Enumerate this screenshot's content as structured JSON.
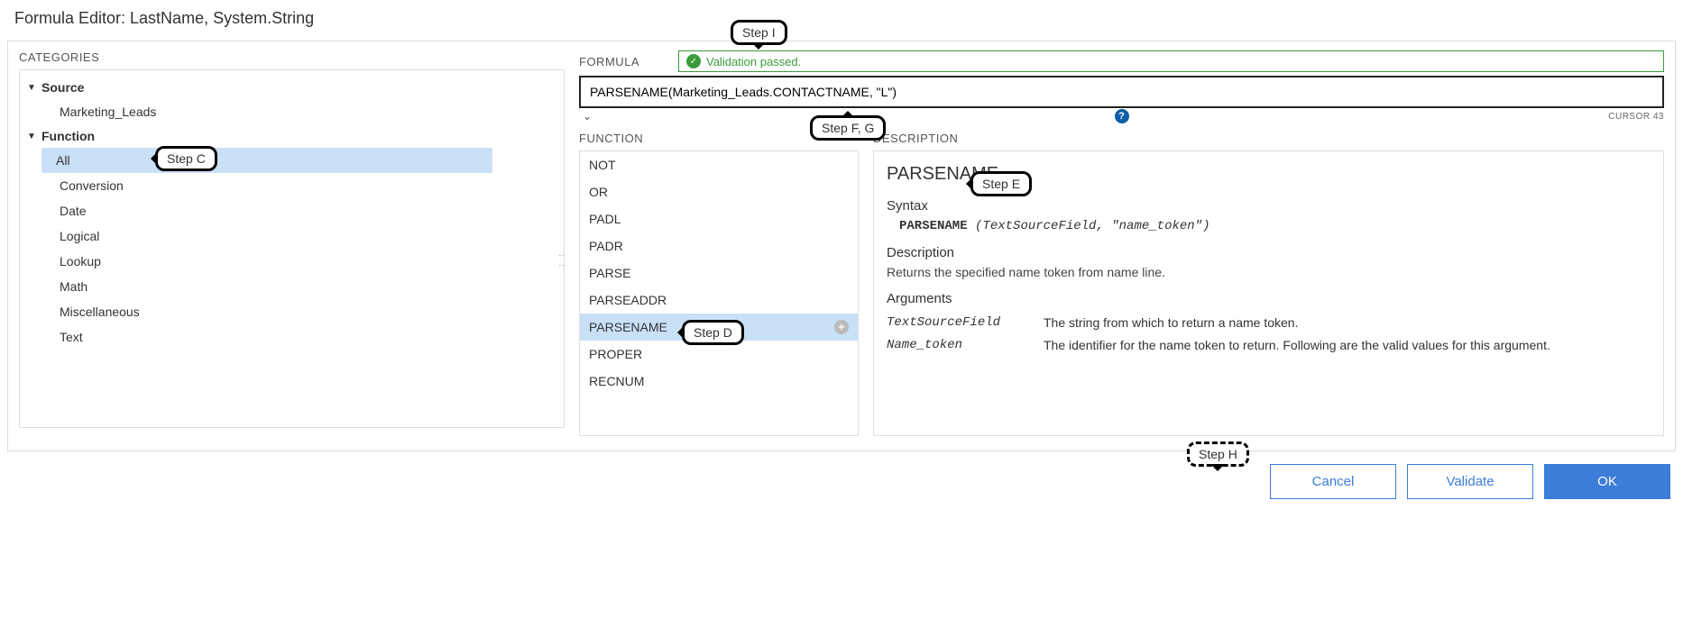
{
  "title": "Formula Editor: LastName, System.String",
  "categories": {
    "header": "CATEGORIES",
    "source_label": "Source",
    "source_items": [
      "Marketing_Leads"
    ],
    "function_label": "Function",
    "function_items": [
      "All",
      "Conversion",
      "Date",
      "Logical",
      "Lookup",
      "Math",
      "Miscellaneous",
      "Text"
    ],
    "selected_function_item": "All"
  },
  "formula": {
    "label": "FORMULA",
    "validation_text": "Validation passed.",
    "input_value": "PARSENAME(Marketing_Leads.CONTACTNAME, \"L\")",
    "cursor_label": "CURSOR 43"
  },
  "function_panel": {
    "header": "FUNCTION",
    "items": [
      "NOT",
      "OR",
      "PADL",
      "PADR",
      "PARSE",
      "PARSEADDR",
      "PARSENAME",
      "PROPER",
      "RECNUM"
    ],
    "selected": "PARSENAME"
  },
  "description": {
    "header": "DESCRIPTION",
    "title": "PARSENAME",
    "syntax_label": "Syntax",
    "syntax_name": "PARSENAME",
    "syntax_args": "(TextSourceField, \"name_token\")",
    "desc_label": "Description",
    "desc_text": "Returns the specified name token from name line.",
    "args_label": "Arguments",
    "args": [
      {
        "name": "TextSourceField",
        "desc": "The string from which to return a name token."
      },
      {
        "name": "Name_token",
        "desc": "The identifier for the name token to return. Following are the valid values for this argument."
      }
    ]
  },
  "buttons": {
    "cancel": "Cancel",
    "validate": "Validate",
    "ok": "OK"
  },
  "callouts": {
    "c": "Step C",
    "d": "Step D",
    "e": "Step E",
    "fg": "Step F, G",
    "h": "Step H",
    "i": "Step I"
  }
}
